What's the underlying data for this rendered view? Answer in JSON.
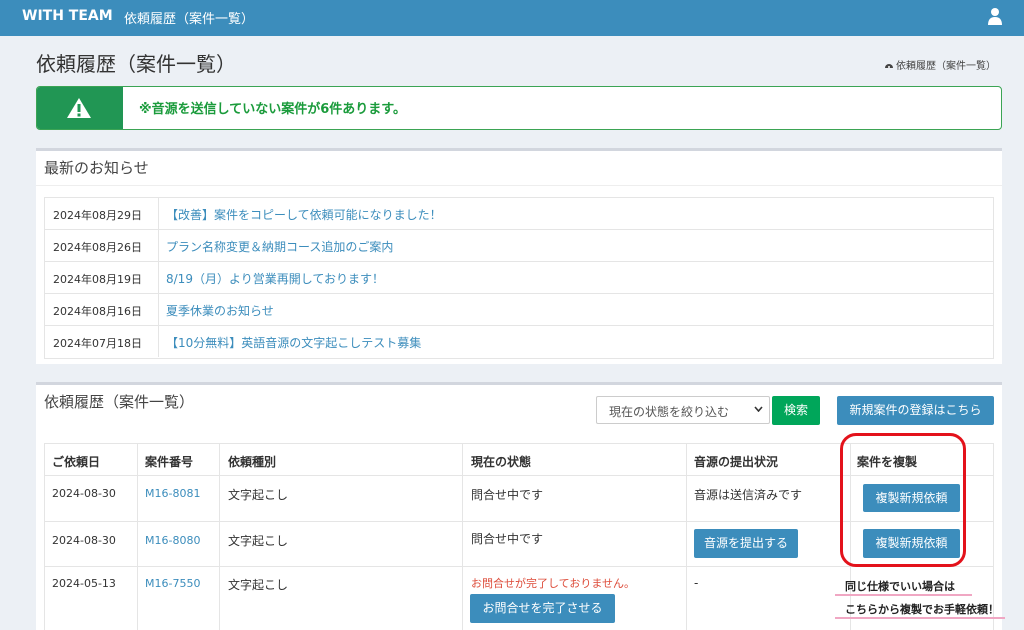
{
  "nav": {
    "brand": "WITH TEAM",
    "link": "依頼履歴（案件一覧）",
    "user_icon": "user-icon"
  },
  "page": {
    "title": "依頼履歴（案件一覧）",
    "breadcrumb": "依頼履歴（案件一覧）"
  },
  "alert": {
    "icon": "warning-icon",
    "text": "※音源を送信していない案件が6件あります。",
    "accent": "#219654"
  },
  "news": {
    "title": "最新のお知らせ",
    "items": [
      {
        "date": "2024年08月29日",
        "text": "【改善】案件をコピーして依頼可能になりました！"
      },
      {
        "date": "2024年08月26日",
        "text": "プラン名称変更＆納期コース追加のご案内"
      },
      {
        "date": "2024年08月19日",
        "text": "8/19（月）より営業再開しております！"
      },
      {
        "date": "2024年08月16日",
        "text": "夏季休業のお知らせ"
      },
      {
        "date": "2024年07月18日",
        "text": "【10分無料】英語音源の文字起こしテスト募集"
      }
    ]
  },
  "history": {
    "title": "依頼履歴（案件一覧）",
    "filter_value": "現在の状態を絞り込む",
    "search_label": "検索",
    "new_label": "新規案件の登録はこちら",
    "headers": [
      "ご依頼日",
      "案件番号",
      "依頼種別",
      "現在の状態",
      "音源の提出状況",
      "案件を複製"
    ],
    "rows": [
      {
        "date": "2024-08-30",
        "id": "M16-8081",
        "type": "文字起こし",
        "status": "問合せ中です",
        "submission": "音源は送信済みです",
        "copy": "複製新規依頼"
      },
      {
        "date": "2024-08-30",
        "id": "M16-8080",
        "type": "文字起こし",
        "status": "問合せ中です",
        "submission_button": "音源を提出する",
        "copy": "複製新規依頼"
      },
      {
        "date": "2024-05-13",
        "id": "M16-7550",
        "type": "文字起こし",
        "status_warning": "お問合せが完了しておりません。",
        "status_button": "お問合せを完了させる",
        "submission": "-"
      }
    ]
  },
  "annotation": {
    "line1": "同じ仕様でいい場合は",
    "line2": "こちらから複製でお手軽依頼！"
  },
  "colors": {
    "header": "#3c8dbc",
    "link": "#3c8dbc",
    "success": "#00a65a",
    "warning_text": "#dd4b39",
    "annotation": "#e3121b"
  }
}
